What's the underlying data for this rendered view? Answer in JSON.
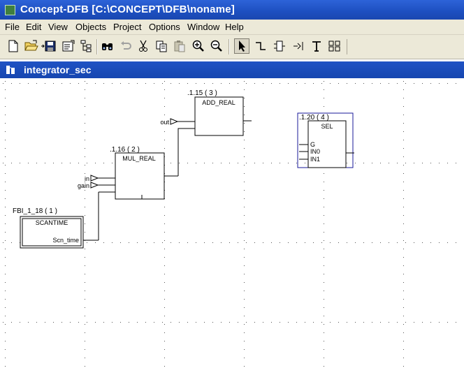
{
  "window": {
    "title": "Concept-DFB [C:\\CONCEPT\\DFB\\noname]"
  },
  "menu": {
    "items": [
      "File",
      "Edit",
      "View",
      "Objects",
      "Project",
      "Options",
      "Window",
      "Help"
    ]
  },
  "toolbar": {
    "buttons": [
      {
        "icon": "new-document-icon"
      },
      {
        "icon": "open-folder-icon"
      },
      {
        "icon": "save-icon"
      },
      {
        "icon": "properties-icon"
      },
      {
        "icon": "tree-view-icon"
      },
      {
        "icon": "find-icon"
      },
      {
        "icon": "undo-icon"
      },
      {
        "icon": "cut-icon"
      },
      {
        "icon": "copy-icon"
      },
      {
        "icon": "paste-icon"
      },
      {
        "icon": "zoom-in-icon"
      },
      {
        "icon": "zoom-out-icon"
      },
      {
        "icon": "select-pointer-icon",
        "active": true
      },
      {
        "icon": "link-tool-icon"
      },
      {
        "icon": "ffb-tool-icon"
      },
      {
        "icon": "variable-tool-icon"
      },
      {
        "icon": "text-tool-icon"
      },
      {
        "icon": "connect-pins-icon"
      }
    ]
  },
  "document": {
    "title": "integrator_sec"
  },
  "diagram": {
    "blocks": [
      {
        "id": "scantime",
        "label": ".1.18 ( 1 )",
        "prefix": "FBI_",
        "name": "SCANTIME",
        "outputs": [
          "Scn_time"
        ]
      },
      {
        "id": "mul",
        "label": ".1.16 ( 2 )",
        "name": "MUL_REAL",
        "inputs": [
          "in",
          "gain"
        ]
      },
      {
        "id": "add",
        "label": ".1.15 ( 3 )",
        "name": "ADD_REAL",
        "inputs": [
          "out"
        ]
      },
      {
        "id": "sel",
        "label": ".1.20 ( 4 )",
        "name": "SEL",
        "inputs": [
          "G",
          "IN0",
          "IN1"
        ],
        "selected": true
      }
    ],
    "scantime_full_label": "FBI_1_18 ( 1 )",
    "colors": {
      "block_border": "#000000",
      "selection": "#1a1a9a",
      "grid_dot": "#555555",
      "window_blue": "#1f52c4"
    }
  }
}
